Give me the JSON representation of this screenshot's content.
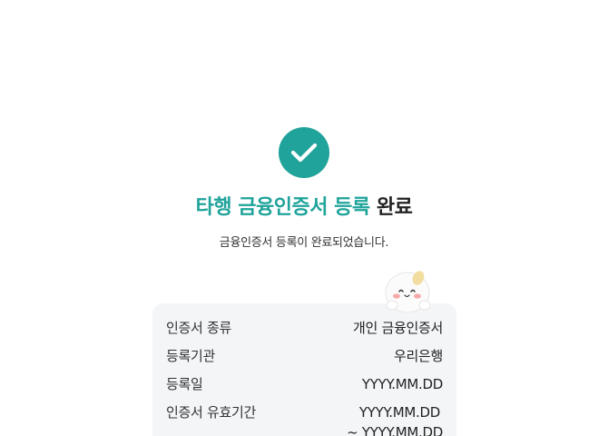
{
  "result": {
    "title_highlight": "타행 금융인증서 등록",
    "title_suffix": "완료",
    "subtitle": "금융인증서 등록이 완료되었습니다."
  },
  "details": {
    "type_label": "인증서 종류",
    "type_value": "개인 금융인증서",
    "bank_label": "등록기관",
    "bank_value": "우리은행",
    "date_label": "등록일",
    "date_value": "YYYY.MM.DD",
    "validity_label": "인증서 유효기간",
    "validity_start": "YYYY.MM.DD",
    "validity_end": "~ YYYY.MM.DD"
  },
  "colors": {
    "accent": "#1fa39a",
    "card_bg": "#f3f5f7"
  },
  "icons": {
    "status": "check-icon",
    "mascot": "mascot-character"
  }
}
